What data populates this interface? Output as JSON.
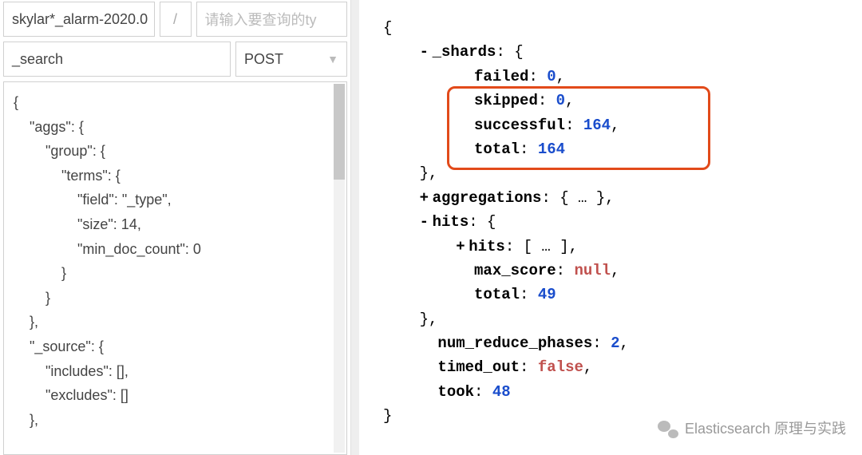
{
  "inputs": {
    "index_value": "skylar*_alarm-2020.0",
    "slash": "/",
    "type_placeholder": "请输入要查询的ty",
    "endpoint": "_search",
    "method": "POST"
  },
  "query_body_lines": [
    "{",
    "    \"aggs\": {",
    "        \"group\": {",
    "            \"terms\": {",
    "                \"field\": \"_type\",",
    "                \"size\": 14,",
    "                \"min_doc_count\": 0",
    "            }",
    "        }",
    "    },",
    "    \"_source\": {",
    "        \"includes\": [],",
    "        \"excludes\": []",
    "    },"
  ],
  "response": {
    "lines": [
      {
        "indent": 0,
        "toggle": "",
        "text": "{"
      },
      {
        "indent": 1,
        "toggle": "-",
        "key": "_shards",
        "after": ": {"
      },
      {
        "indent": 2,
        "toggle": "",
        "key": "failed",
        "after": ": ",
        "val": "0",
        "valtype": "num",
        "tail": ","
      },
      {
        "indent": 2,
        "toggle": "",
        "key": "skipped",
        "after": ": ",
        "val": "0",
        "valtype": "num",
        "tail": ","
      },
      {
        "indent": 2,
        "toggle": "",
        "key": "successful",
        "after": ": ",
        "val": "164",
        "valtype": "num",
        "tail": ","
      },
      {
        "indent": 2,
        "toggle": "",
        "key": "total",
        "after": ": ",
        "val": "164",
        "valtype": "num",
        "tail": ""
      },
      {
        "indent": 1,
        "toggle": "",
        "text": "},"
      },
      {
        "indent": 1,
        "toggle": "+",
        "key": "aggregations",
        "after": ": { … },"
      },
      {
        "indent": 1,
        "toggle": "-",
        "key": "hits",
        "after": ": {"
      },
      {
        "indent": 2,
        "toggle": "+",
        "key": "hits",
        "after": ": [ … ],"
      },
      {
        "indent": 2,
        "toggle": "",
        "key": "max_score",
        "after": ": ",
        "val": "null",
        "valtype": "null",
        "tail": ","
      },
      {
        "indent": 2,
        "toggle": "",
        "key": "total",
        "after": ": ",
        "val": "49",
        "valtype": "num",
        "tail": ""
      },
      {
        "indent": 1,
        "toggle": "",
        "text": "},"
      },
      {
        "indent": 1,
        "toggle": "",
        "key": "num_reduce_phases",
        "after": ": ",
        "val": "2",
        "valtype": "num",
        "tail": ","
      },
      {
        "indent": 1,
        "toggle": "",
        "key": "timed_out",
        "after": ": ",
        "val": "false",
        "valtype": "null",
        "tail": ","
      },
      {
        "indent": 1,
        "toggle": "",
        "key": "took",
        "after": ": ",
        "val": "48",
        "valtype": "num",
        "tail": ""
      },
      {
        "indent": 0,
        "toggle": "",
        "text": "}"
      }
    ]
  },
  "credit": "Elasticsearch 原理与实践"
}
